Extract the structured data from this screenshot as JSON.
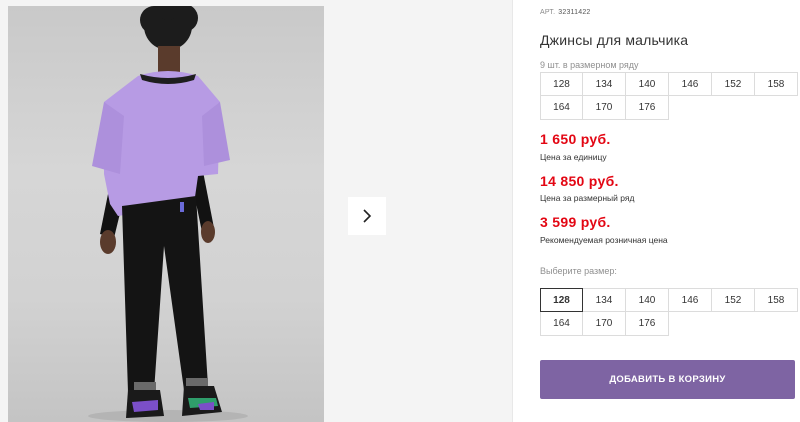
{
  "product": {
    "sku_label": "арт.",
    "sku_value": "32311422",
    "title": "Джинсы для мальчика",
    "row_count_text": "9 шт. в размерном ряду"
  },
  "size_row": [
    "128",
    "134",
    "140",
    "146",
    "152",
    "158",
    "164",
    "170",
    "176"
  ],
  "prices": {
    "unit_price": "1 650 руб.",
    "unit_label": "Цена за единицу",
    "row_price": "14 850 руб.",
    "row_label": "Цена за размерный ряд",
    "retail_price": "3 599 руб.",
    "retail_label": "Рекомендуемая розничная цена"
  },
  "size_select": {
    "label": "Выберите размер:",
    "options": [
      "128",
      "134",
      "140",
      "146",
      "152",
      "158",
      "164",
      "170",
      "176"
    ],
    "selected": "128"
  },
  "cart": {
    "button_label": "Добавить в корзину"
  },
  "icons": {
    "next": "chevron-right-icon"
  },
  "colors": {
    "accent": "#7e64a3",
    "price": "#e30613"
  }
}
